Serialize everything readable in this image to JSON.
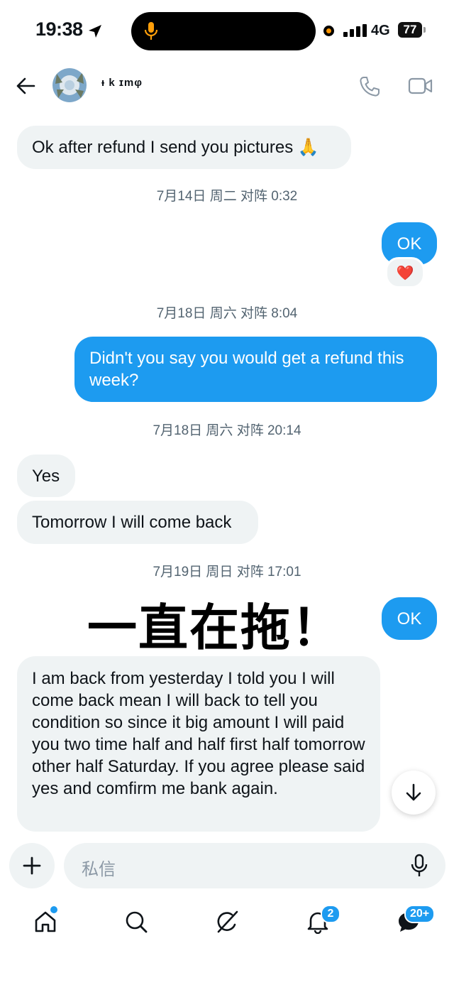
{
  "status_bar": {
    "time": "19:38",
    "network": "4G",
    "battery": "77"
  },
  "header": {
    "username": "ᵻ k ɪmφ"
  },
  "messages": {
    "m1": "Ok after refund I send you pictures 🙏",
    "t1": "7月14日 周二 对阵 0:32",
    "m2": "OK",
    "reaction": "❤️",
    "t2": "7月18日 周六 对阵 8:04",
    "m3": "Didn't you say you would get a refund this week?",
    "t3": "7月18日 周六 对阵 20:14",
    "m4": "Yes",
    "m5": "Tomorrow I will come back",
    "t4": "7月19日 周日 对阵 17:01",
    "m6": "OK",
    "m7": "I am back from yesterday I told you I will come back mean I will back to tell you condition so since it big amount I will paid you two time half and half first half tomorrow other half Saturday. If you agree please said yes and comfirm me bank again."
  },
  "overlay": {
    "text": "一直在拖！"
  },
  "composer": {
    "placeholder": "私信"
  },
  "nav": {
    "notifications_badge": "2",
    "messages_badge": "20+"
  },
  "colors": {
    "accent": "#1d9bf0",
    "incoming_bubble": "#eff3f4",
    "timestamp": "#536471"
  },
  "icons": [
    "back-arrow-icon",
    "phone-icon",
    "video-icon",
    "mic-icon",
    "plus-icon",
    "arrow-down-icon",
    "home-icon",
    "search-icon",
    "grok-icon",
    "bell-icon",
    "messages-icon"
  ]
}
